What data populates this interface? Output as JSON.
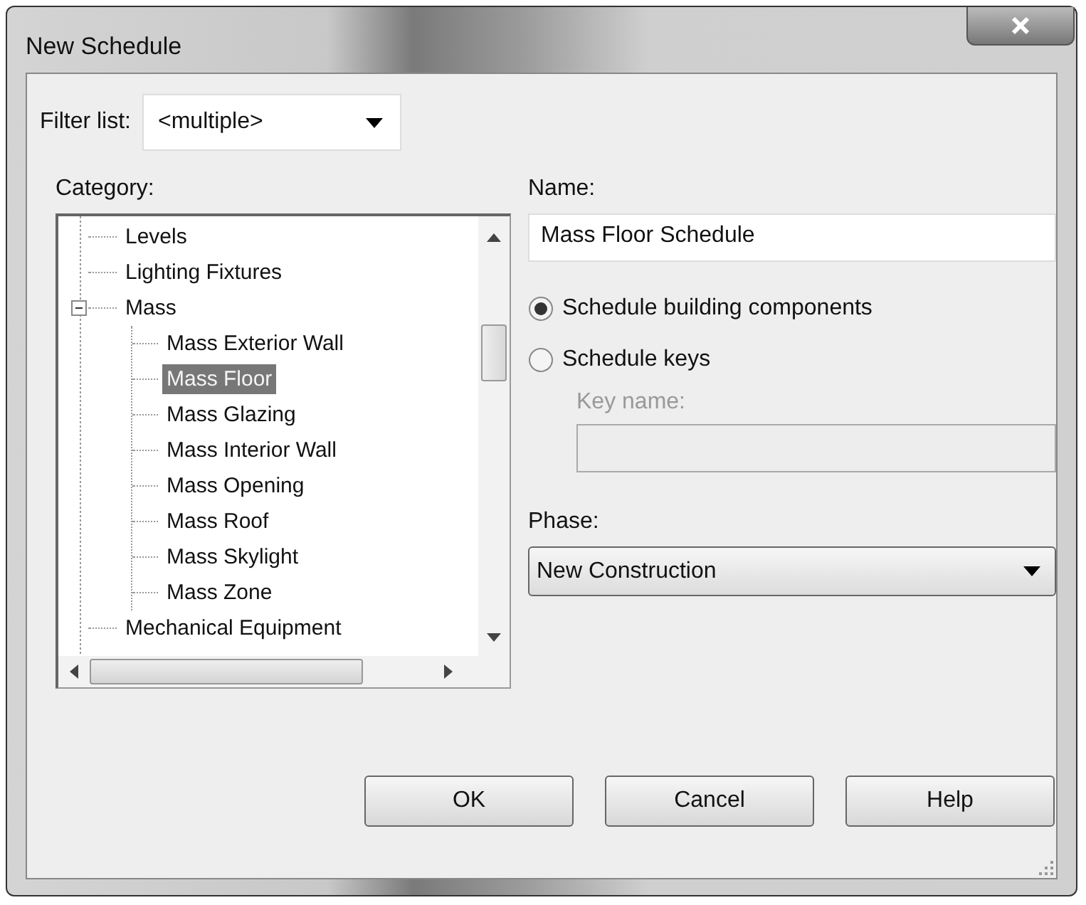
{
  "window": {
    "title": "New Schedule"
  },
  "filter": {
    "label": "Filter list:",
    "value": "<multiple>"
  },
  "category": {
    "label": "Category:",
    "items": [
      {
        "label": "Levels",
        "selected": false
      },
      {
        "label": "Lighting Fixtures",
        "selected": false
      },
      {
        "label": "Mass",
        "selected": false,
        "expanded": true,
        "children": [
          {
            "label": "Mass Exterior Wall",
            "selected": false
          },
          {
            "label": "Mass Floor",
            "selected": true
          },
          {
            "label": "Mass Glazing",
            "selected": false
          },
          {
            "label": "Mass Interior Wall",
            "selected": false
          },
          {
            "label": "Mass Opening",
            "selected": false
          },
          {
            "label": "Mass Roof",
            "selected": false
          },
          {
            "label": "Mass Skylight",
            "selected": false
          },
          {
            "label": "Mass Zone",
            "selected": false
          }
        ]
      },
      {
        "label": "Mechanical Equipment",
        "selected": false
      }
    ]
  },
  "name": {
    "label": "Name:",
    "value": "Mass Floor Schedule"
  },
  "schedule_type": [
    {
      "label": "Schedule building components",
      "selected": true
    },
    {
      "label": "Schedule keys",
      "selected": false
    }
  ],
  "key_name": {
    "label": "Key name:",
    "disabled": true
  },
  "phase": {
    "label": "Phase:",
    "value": "New Construction"
  },
  "buttons": [
    "OK",
    "Cancel",
    "Help"
  ]
}
